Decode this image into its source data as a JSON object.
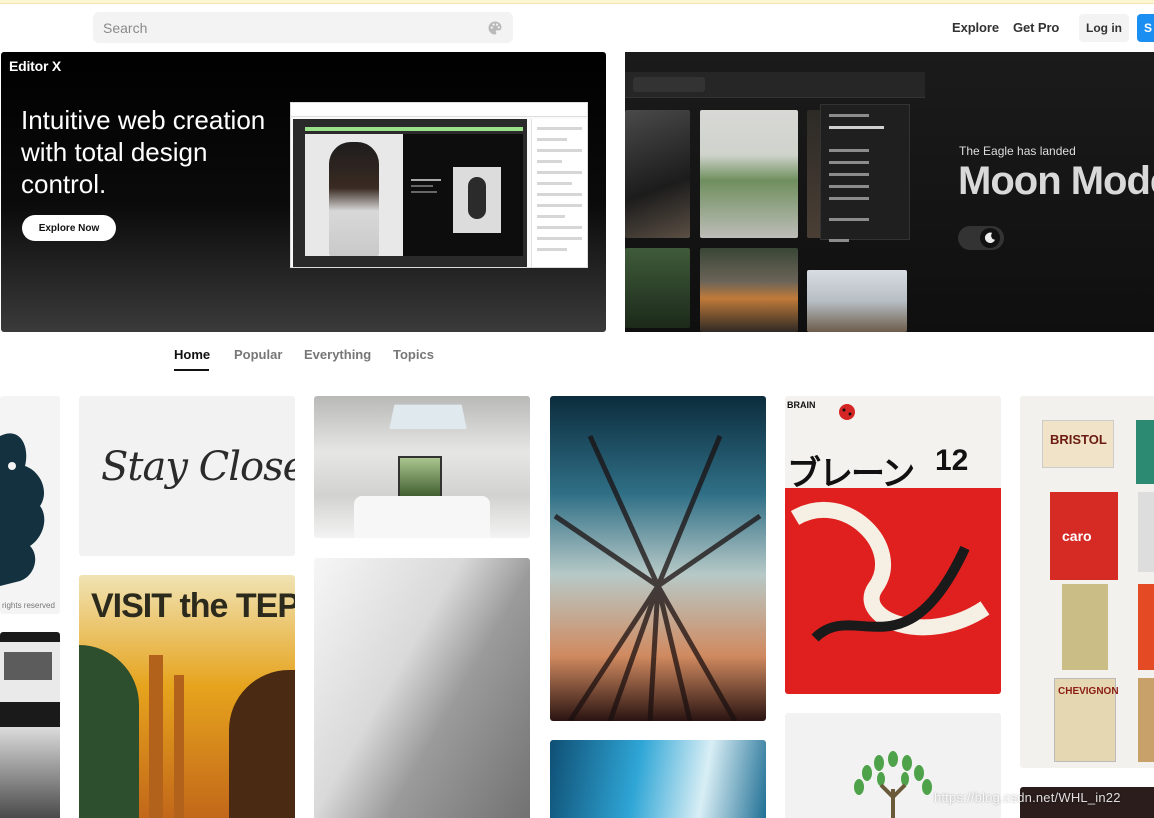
{
  "header": {
    "search_placeholder": "Search",
    "nav": {
      "explore": "Explore",
      "get_pro": "Get Pro"
    },
    "login_label": "Log in",
    "signup_label": "S",
    "icons": {
      "search": "palette-icon"
    }
  },
  "banner_left": {
    "brand": "Editor X",
    "headline": "Intuitive web creation with total design control.",
    "cta": "Explore Now",
    "mock_product": "JAYS Wireless"
  },
  "banner_right": {
    "tagline": "The Eagle has landed",
    "title": "Moon Mode"
  },
  "tabs": [
    {
      "label": "Home",
      "active": true
    },
    {
      "label": "Popular",
      "active": false
    },
    {
      "label": "Everything",
      "active": false
    },
    {
      "label": "Topics",
      "active": false
    }
  ],
  "shots": {
    "stay_close": "Stay Close",
    "visit_tepui": "VISIT the TEPUI",
    "brain_title": "ブレーン",
    "brain_number": "12",
    "brain_header": "BRAIN",
    "bristol": "BRISTOL",
    "caro": "caro",
    "chevignon": "CHEVIGNON",
    "rights": "rights reserved"
  },
  "watermark": "https://blog.csdn.net/WHL_in22",
  "colors": {
    "accent_blue": "#1b8ef2",
    "text_dark": "#222222",
    "muted": "#777777"
  }
}
